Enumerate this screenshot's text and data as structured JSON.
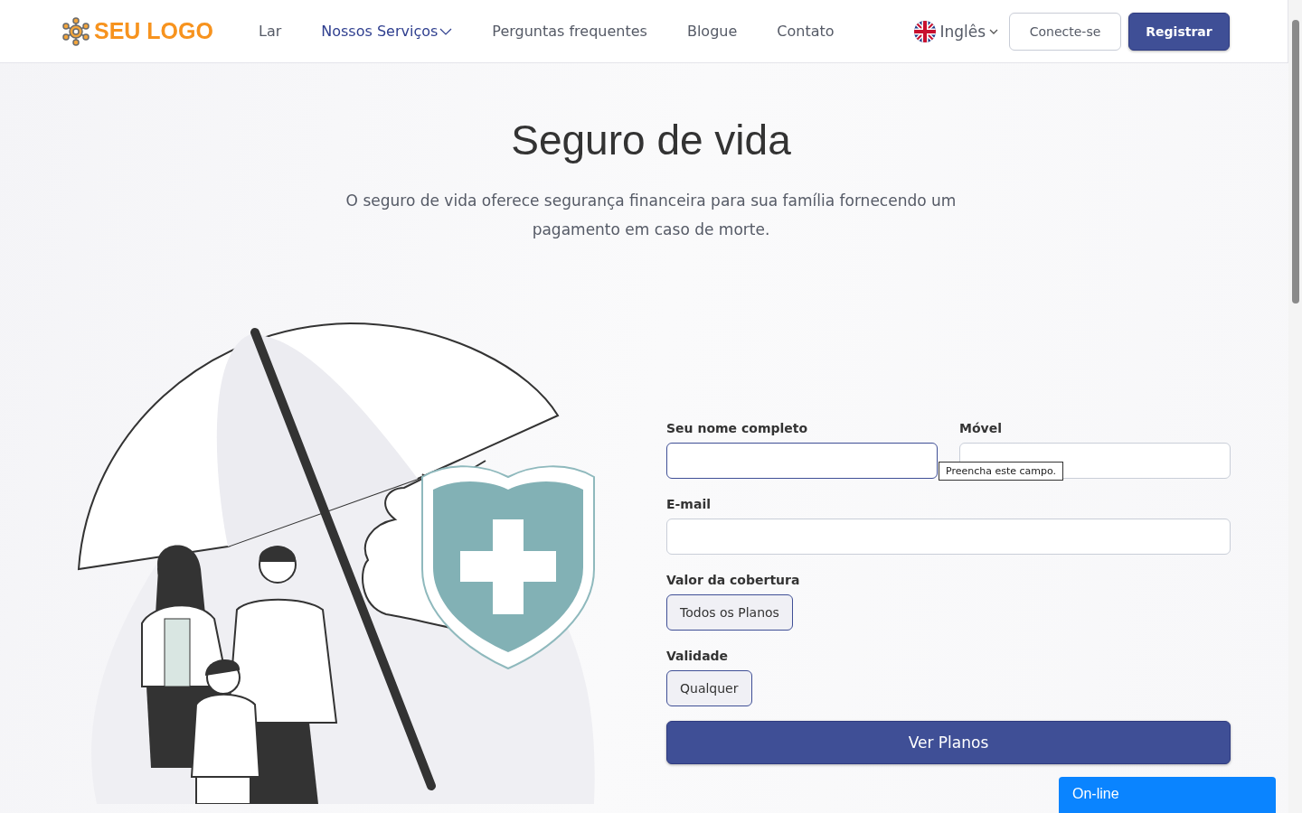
{
  "header": {
    "logo": "SEU LOGO",
    "nav": [
      {
        "label": "Lar",
        "selected": false,
        "dropdown": false
      },
      {
        "label": "Nossos Serviços",
        "selected": true,
        "dropdown": true
      },
      {
        "label": "Perguntas frequentes",
        "selected": false,
        "dropdown": false
      },
      {
        "label": "Blogue",
        "selected": false,
        "dropdown": false
      },
      {
        "label": "Contato",
        "selected": false,
        "dropdown": false
      }
    ],
    "language": "Inglês",
    "login_button": "Conecte-se",
    "register_button": "Registrar"
  },
  "hero": {
    "title": "Seguro de vida",
    "subtitle": "O seguro de vida oferece segurança financeira para sua família fornecendo um pagamento em caso de morte."
  },
  "form": {
    "fields": [
      {
        "kind": "half_input",
        "label": "Seu nome completo",
        "focused": true
      },
      {
        "kind": "half_input",
        "label": "Móvel",
        "focused": false
      },
      {
        "kind": "full_input",
        "label": "E-mail",
        "focused": false
      },
      {
        "kind": "choice",
        "label": "Valor da cobertura",
        "value": "Todos os Planos"
      },
      {
        "kind": "choice",
        "label": "Validade",
        "value": "Qualquer"
      }
    ],
    "tooltip": "Preencha este campo.",
    "submit": "Ver Planos"
  },
  "chat": {
    "label": "On-line"
  }
}
